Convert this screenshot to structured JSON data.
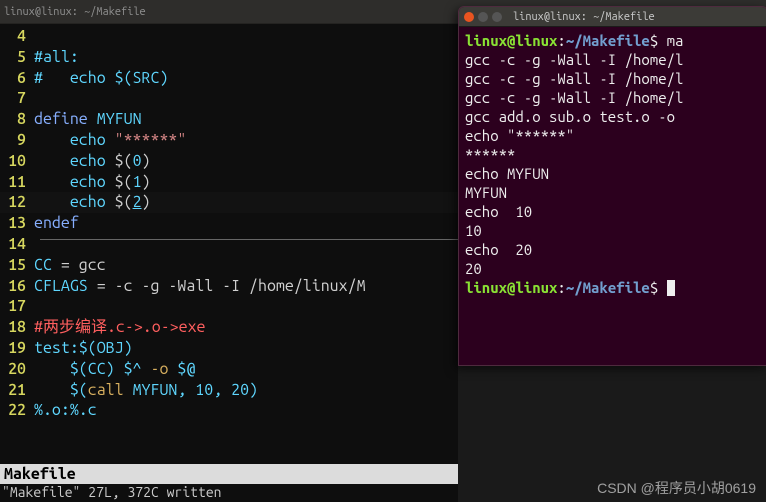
{
  "topbar": {
    "title": "linux@linux: ~/Makefile"
  },
  "editor": {
    "lines": [
      {
        "n": 4,
        "segs": []
      },
      {
        "n": 5,
        "segs": [
          {
            "t": "#all:",
            "c": "c-comment"
          }
        ]
      },
      {
        "n": 6,
        "segs": [
          {
            "t": "#   echo $(SRC)",
            "c": "c-comment"
          }
        ]
      },
      {
        "n": 7,
        "segs": []
      },
      {
        "n": 8,
        "segs": [
          {
            "t": "define",
            "c": "c-keyword"
          },
          {
            "t": " ",
            "c": ""
          },
          {
            "t": "MYFUN",
            "c": "c-identifier"
          }
        ]
      },
      {
        "n": 9,
        "segs": [
          {
            "t": "    echo ",
            "c": "c-identifier"
          },
          {
            "t": "\"******\"",
            "c": "c-string"
          }
        ]
      },
      {
        "n": 10,
        "segs": [
          {
            "t": "    echo ",
            "c": "c-identifier"
          },
          {
            "t": "$(",
            "c": "c-operator"
          },
          {
            "t": "0",
            "c": "c-identifier"
          },
          {
            "t": ")",
            "c": "c-operator"
          }
        ]
      },
      {
        "n": 11,
        "segs": [
          {
            "t": "    echo ",
            "c": "c-identifier"
          },
          {
            "t": "$(",
            "c": "c-operator"
          },
          {
            "t": "1",
            "c": "c-identifier"
          },
          {
            "t": ")",
            "c": "c-operator"
          }
        ]
      },
      {
        "n": 12,
        "segs": [
          {
            "t": "    echo ",
            "c": "c-identifier"
          },
          {
            "t": "$(",
            "c": "c-operator"
          },
          {
            "t": "2",
            "c": "c-identifier underline"
          },
          {
            "t": ")",
            "c": "c-operator"
          }
        ],
        "cursor": true
      },
      {
        "n": 13,
        "segs": [
          {
            "t": "endef",
            "c": "c-keyword"
          }
        ]
      },
      {
        "n": 14,
        "segs": []
      },
      {
        "n": 15,
        "segs": [
          {
            "t": "CC",
            "c": "c-identifier"
          },
          {
            "t": " = gcc",
            "c": "c-operator"
          }
        ]
      },
      {
        "n": 16,
        "segs": [
          {
            "t": "CFLAGS",
            "c": "c-identifier"
          },
          {
            "t": " = -c -g -Wall -I /home/linux/M",
            "c": "c-operator"
          }
        ]
      },
      {
        "n": 17,
        "segs": []
      },
      {
        "n": 18,
        "segs": [
          {
            "t": "#两步编译.c->.o->exe",
            "c": "c-cjk"
          }
        ]
      },
      {
        "n": 19,
        "segs": [
          {
            "t": "test:",
            "c": "c-identifier"
          },
          {
            "t": "$(OBJ)",
            "c": "c-identifier"
          }
        ]
      },
      {
        "n": 20,
        "segs": [
          {
            "t": "    $(CC) $^ ",
            "c": "c-identifier"
          },
          {
            "t": "-o",
            "c": "c-call"
          },
          {
            "t": " $@",
            "c": "c-identifier"
          }
        ]
      },
      {
        "n": 21,
        "segs": [
          {
            "t": "    $(",
            "c": "c-identifier"
          },
          {
            "t": "call",
            "c": "c-call"
          },
          {
            "t": " MYFUN, 10, 20)",
            "c": "c-identifier"
          }
        ]
      },
      {
        "n": 22,
        "segs": [
          {
            "t": "%.o:%.c",
            "c": "c-identifier"
          }
        ]
      }
    ],
    "statusbar": "Makefile",
    "cmdline": "\"Makefile\" 27L, 372C written"
  },
  "terminal": {
    "title": "linux@linux: ~/Makefile",
    "output": [
      {
        "kind": "prompt-cmd",
        "user": "linux@linux",
        "path": "~/Makefile",
        "cmd": "ma"
      },
      {
        "kind": "text",
        "t": "gcc -c -g -Wall -I /home/l"
      },
      {
        "kind": "text",
        "t": "gcc -c -g -Wall -I /home/l"
      },
      {
        "kind": "text",
        "t": "gcc -c -g -Wall -I /home/l"
      },
      {
        "kind": "text",
        "t": "gcc add.o sub.o test.o -o "
      },
      {
        "kind": "text",
        "t": "echo \"******\""
      },
      {
        "kind": "text",
        "t": "******"
      },
      {
        "kind": "text",
        "t": "echo MYFUN"
      },
      {
        "kind": "text",
        "t": "MYFUN"
      },
      {
        "kind": "text",
        "t": "echo  10"
      },
      {
        "kind": "text",
        "t": "10"
      },
      {
        "kind": "text",
        "t": "echo  20"
      },
      {
        "kind": "text",
        "t": "20"
      },
      {
        "kind": "prompt",
        "user": "linux@linux",
        "path": "~/Makefile"
      }
    ]
  },
  "watermark": "CSDN @程序员小胡0619"
}
